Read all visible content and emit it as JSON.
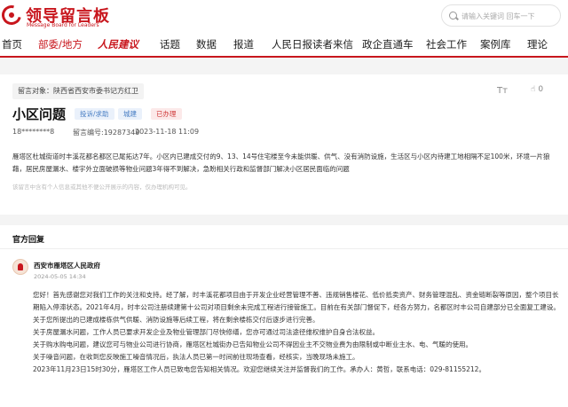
{
  "header": {
    "logo_title": "领导留言板",
    "logo_subtitle": "Message Board for Leaders",
    "search_placeholder": "请输入关键词 回车一下"
  },
  "nav": {
    "items": [
      "首页",
      "部委/地方",
      "人民建议",
      "话题",
      "数据",
      "报道",
      "人民日报读者来信",
      "政企直通车",
      "社会工作",
      "案例库",
      "理论"
    ]
  },
  "message": {
    "recipient": "留言对象：陕西省西安市委书记方红卫",
    "font_label": "Tт",
    "likes": "0",
    "title": "小区问题",
    "tags": [
      "投诉/求助",
      "城建",
      "已办理"
    ],
    "author": "18********8",
    "number": "留言编号:19287349",
    "datetime": "2023-11-18 11:09",
    "content": "雁塔区杜城街道时丰溪花都名都区已尾拓达7年。小区内已建成交付的9、13、14号住宅楼至今未能供暖、供气、没有消防设施，生活区与小区内待建工地相隔不足100米，环境一片狼藉，居民房屋漏水、楼宇外立面破损等物业问题3年得不到解决，急盼相关行政和监督部门解决小区居民面临的问题",
    "disclaimer": "该留言中含有个人信息或其他不便公开展示的内容，仅办理机构可见。"
  },
  "reply": {
    "heading": "官方回复",
    "org": "西安市雁塔区人民政府",
    "time": "2024-05-05 14:34",
    "paragraphs": [
      "您好！首先感谢您对我们工作的关注和支持。经了解，时丰溪花都项目由于开发企业经营管理不善、违规销售楼花、低价抵卖资产、财务管理混乱、资金链断裂等原因，整个项目长期陷入停滞状态。2021年4月，时丰公司注册续建第十公司对项目剩余未完成工程进行接管施工。目前在有关部门督促下，经各方努力，名都区时丰公司自建部分已全面复工建设。",
      "关于您所提出的已建成楼栋供气供暖、消防设施等后续工程，将在剩余楼栋交付后逐步进行完善。",
      "关于房屋漏水问题，工作人员已要求开发企业及物业管理部门尽快修缮，您亦可通过司法途径维权维护自身合法权益。",
      "关于购水购电问题，建议您可与物业公司进行协商，雁塔区杜城街办已告知物业公司不得因业主不交物业费为由限制或中断业主水、电、气暖的使用。",
      "关于噪音问题，在收到您反映施工噪音情况后，执法人员已第一时间前往现场查看，经核实，当晚现场未施工。",
      "2023年11月23日15时30分，雁塔区工作人员已致电您告知相关情况。欢迎您继续关注并监督我们的工作。承办人：黄哲，联系电话：029-81155212。"
    ]
  }
}
